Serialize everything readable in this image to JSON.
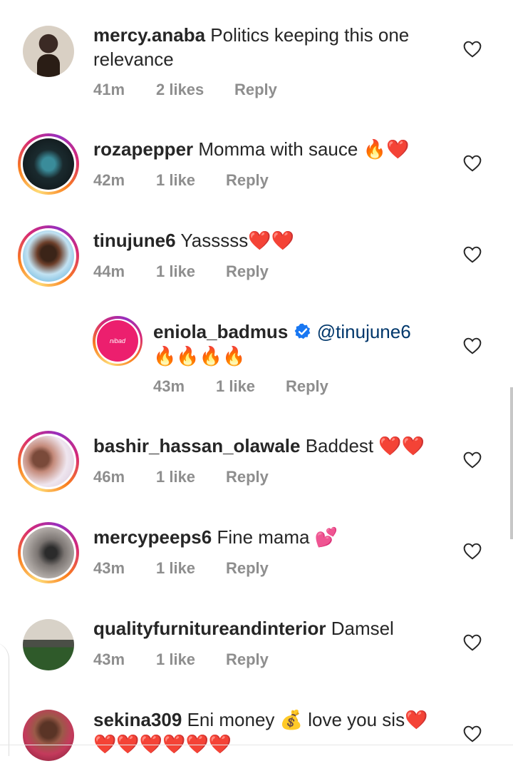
{
  "comments": [
    {
      "username": "mercy.anaba",
      "text": "Politics keeping this one relevance",
      "time": "41m",
      "likes": "2 likes",
      "reply": "Reply"
    },
    {
      "username": "rozapepper",
      "text": "Momma with sauce 🔥❤️",
      "time": "42m",
      "likes": "1 like",
      "reply": "Reply"
    },
    {
      "username": "tinujune6",
      "text": "Yasssss❤️❤️",
      "time": "44m",
      "likes": "1 like",
      "reply": "Reply"
    },
    {
      "username": "eniola_badmus",
      "mention": "@tinujune6",
      "text": "🔥🔥🔥🔥",
      "time": "43m",
      "likes": "1 like",
      "reply": "Reply",
      "verified": true,
      "avatar_text": "nibad"
    },
    {
      "username": "bashir_hassan_olawale",
      "text": "Baddest ❤️❤️",
      "time": "46m",
      "likes": "1 like",
      "reply": "Reply"
    },
    {
      "username": "mercypeeps6",
      "text": "Fine mama 💕",
      "time": "43m",
      "likes": "1 like",
      "reply": "Reply"
    },
    {
      "username": "qualityfurnitureandinterior",
      "text": "Damsel",
      "time": "43m",
      "likes": "1 like",
      "reply": "Reply"
    },
    {
      "username": "sekina309",
      "text": "Eni money 💰 love you sis❤️",
      "text2": "❤️❤️❤️❤️❤️❤️"
    }
  ],
  "colors": {
    "username": "#262626",
    "meta": "#8e8e8e",
    "mention": "#00376b",
    "verified": "#1877f2",
    "reply_avatar": "#ec1f6e"
  },
  "icons": {
    "like": "heart-outline-icon",
    "verified": "verified-badge-icon"
  }
}
